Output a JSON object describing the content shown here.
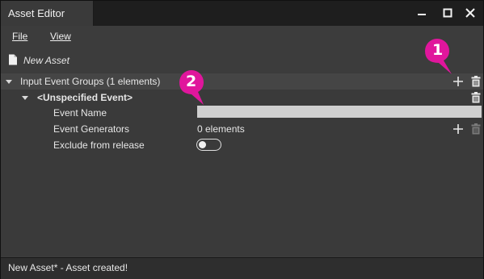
{
  "window": {
    "title": "Asset Editor"
  },
  "menu": {
    "file": "File",
    "view": "View"
  },
  "toolbar": {
    "asset_name": "New Asset"
  },
  "tree": {
    "group_label": "Input Event Groups (1 elements)",
    "event_label": "<Unspecified Event>",
    "fields": {
      "event_name_label": "Event Name",
      "event_name_value": "",
      "generators_label": "Event Generators",
      "generators_value": "0 elements",
      "exclude_label": "Exclude from release",
      "exclude_value": false
    }
  },
  "status": {
    "message": "New Asset* - Asset created!"
  },
  "callouts": {
    "one": "1",
    "two": "2"
  },
  "colors": {
    "callout": "#e0169c",
    "background": "#3c3c3c",
    "titlebar": "#1e1e1e",
    "input": "#cfcfcf"
  },
  "icons": [
    "minimize-icon",
    "maximize-icon",
    "close-icon",
    "document-icon",
    "expand-arrow-icon",
    "plus-icon",
    "trash-icon"
  ]
}
